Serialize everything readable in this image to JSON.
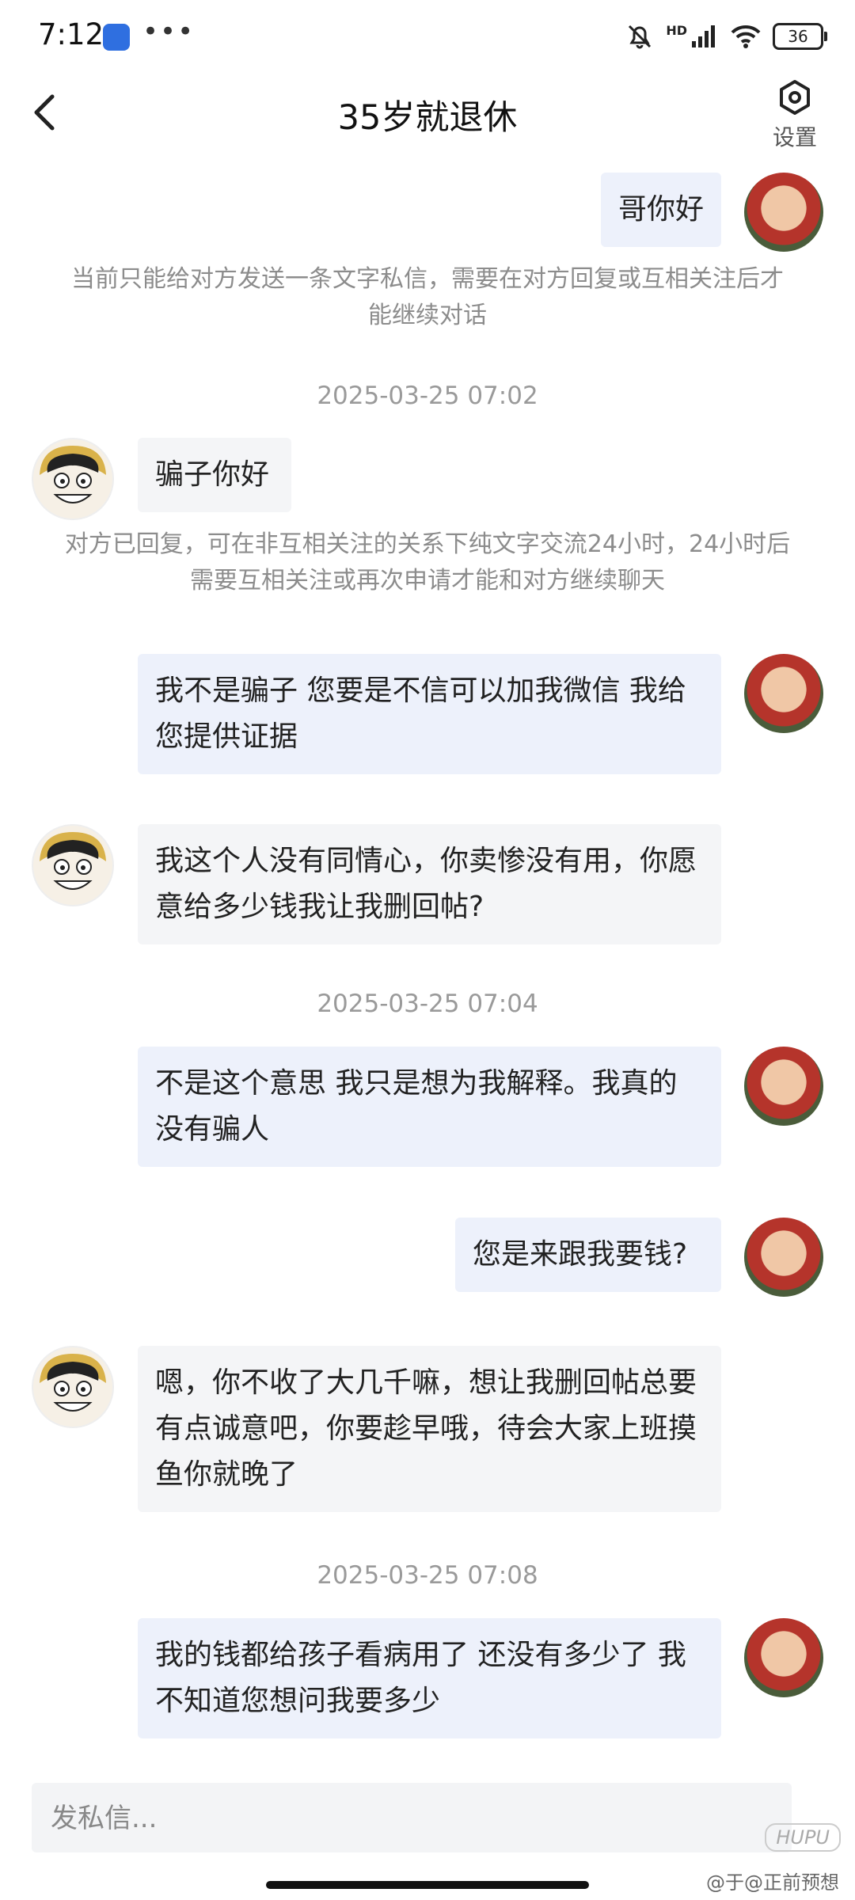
{
  "status": {
    "time": "7:12",
    "dots": "•••",
    "network": "HD",
    "battery": "36"
  },
  "header": {
    "title": "35岁就退休",
    "settings_label": "设置"
  },
  "messages": [
    {
      "text": "哥你好"
    },
    {
      "text": "骗子你好"
    },
    {
      "text": "我不是骗子 您要是不信可以加我微信 我给您提供证据"
    },
    {
      "text": "我这个人没有同情心，你卖惨没有用，你愿意给多少钱我让我删回帖?"
    },
    {
      "text": "不是这个意思 我只是想为我解释。我真的没有骗人"
    },
    {
      "text": "您是来跟我要钱?"
    },
    {
      "text": "嗯，你不收了大几千嘛，想让我删回帖总要有点诚意吧，你要趁早哦，待会大家上班摸鱼你就晚了"
    },
    {
      "text": "我的钱都给孩子看病用了 还没有多少了 我不知道您想问我要多少"
    }
  ],
  "notes": [
    "当前只能给对方发送一条文字私信，需要在对方回复或互相关注后才能继续对话",
    "对方已回复，可在非互相关注的关系下纯文字交流24小时，24小时后需要互相关注或再次申请才能和对方继续聊天"
  ],
  "timestamps": [
    "2025-03-25 07:02",
    "2025-03-25 07:04",
    "2025-03-25 07:08"
  ],
  "composer": {
    "placeholder": "发私信..."
  },
  "watermark": {
    "logo": "HUPU",
    "text": "@于@正前预想"
  },
  "colors": {
    "bubble_mine": "#edf1fb",
    "bubble_other": "#f4f5f7",
    "note_text": "#8c8c8c"
  }
}
